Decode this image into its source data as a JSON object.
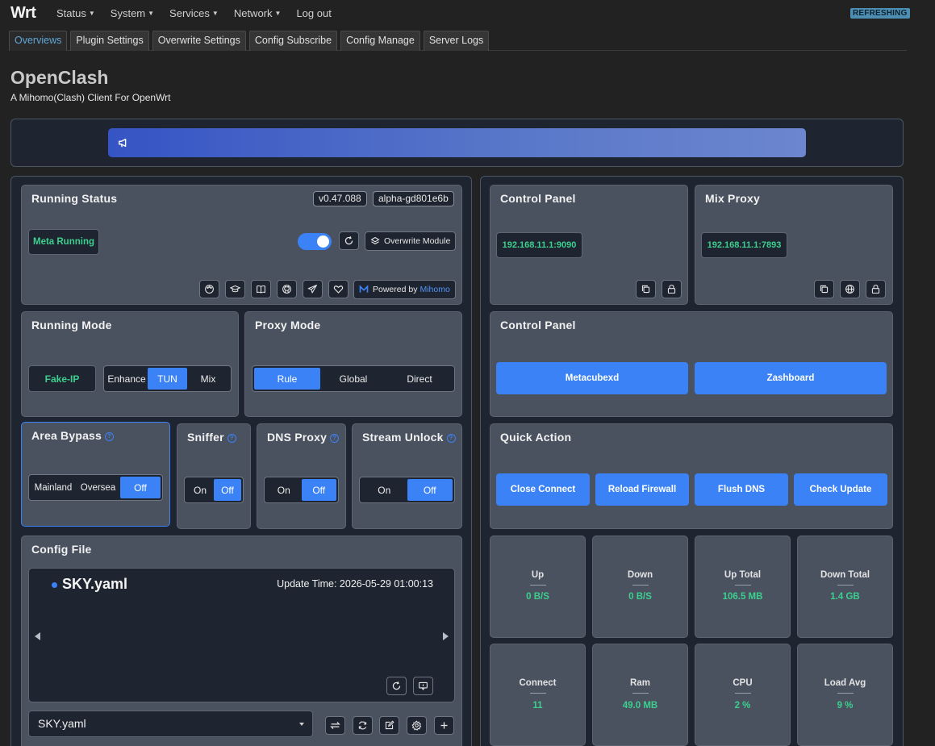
{
  "nav": {
    "brand": "Wrt",
    "menu": [
      "Status",
      "System",
      "Services",
      "Network",
      "Log out"
    ],
    "status_badge": "REFRESHING"
  },
  "tabs": [
    "Overviews",
    "Plugin Settings",
    "Overwrite Settings",
    "Config Subscribe",
    "Config Manage",
    "Server Logs"
  ],
  "page": {
    "title": "OpenClash",
    "subtitle": "A Mihomo(Clash) Client For OpenWrt"
  },
  "running_status": {
    "title": "Running Status",
    "version": "v0.47.088",
    "core_version": "alpha-gd801e6b",
    "state": "Meta Running",
    "overwrite_module": "Overwrite Module",
    "powered_by": "Powered by",
    "powered_name": "Mihomo"
  },
  "control_panel_addr": {
    "title": "Control Panel",
    "address": "192.168.11.1:9090"
  },
  "mix_proxy": {
    "title": "Mix Proxy",
    "address": "192.168.11.1:7893"
  },
  "running_mode": {
    "title": "Running Mode",
    "dns_mode": "Fake-IP",
    "options": [
      "Enhance",
      "TUN",
      "Mix"
    ],
    "selected": "TUN"
  },
  "proxy_mode": {
    "title": "Proxy Mode",
    "options": [
      "Rule",
      "Global",
      "Direct"
    ],
    "selected": "Rule"
  },
  "dashboards": {
    "title": "Control Panel",
    "buttons": [
      "Metacubexd",
      "Zashboard"
    ]
  },
  "area_bypass": {
    "title": "Area Bypass",
    "options": [
      "Mainland",
      "Oversea",
      "Off"
    ],
    "selected": "Off"
  },
  "sniffer": {
    "title": "Sniffer",
    "options": [
      "On",
      "Off"
    ],
    "selected": "Off"
  },
  "dns_proxy": {
    "title": "DNS Proxy",
    "options": [
      "On",
      "Off"
    ],
    "selected": "Off"
  },
  "stream_unlock": {
    "title": "Stream Unlock",
    "options": [
      "On",
      "Off"
    ],
    "selected": "Off"
  },
  "quick_action": {
    "title": "Quick Action",
    "buttons": [
      "Close Connect",
      "Reload Firewall",
      "Flush DNS",
      "Check Update"
    ]
  },
  "config_file": {
    "title": "Config File",
    "name": "SKY.yaml",
    "update_time": "Update Time: 2026-05-29 01:00:13",
    "selected": "SKY.yaml"
  },
  "stats": [
    {
      "label": "Up",
      "value": "0 B/S"
    },
    {
      "label": "Down",
      "value": "0 B/S"
    },
    {
      "label": "Up Total",
      "value": "106.5 MB"
    },
    {
      "label": "Down Total",
      "value": "1.4 GB"
    },
    {
      "label": "Connect",
      "value": "11"
    },
    {
      "label": "Ram",
      "value": "49.0 MB"
    },
    {
      "label": "CPU",
      "value": "2 %"
    },
    {
      "label": "Load Avg",
      "value": "9 %"
    }
  ],
  "colors": {
    "accent": "#3b82f6",
    "status_green": "#3ccf8e",
    "card_bg": "#4a5260",
    "dark_bg": "#1f2530"
  }
}
